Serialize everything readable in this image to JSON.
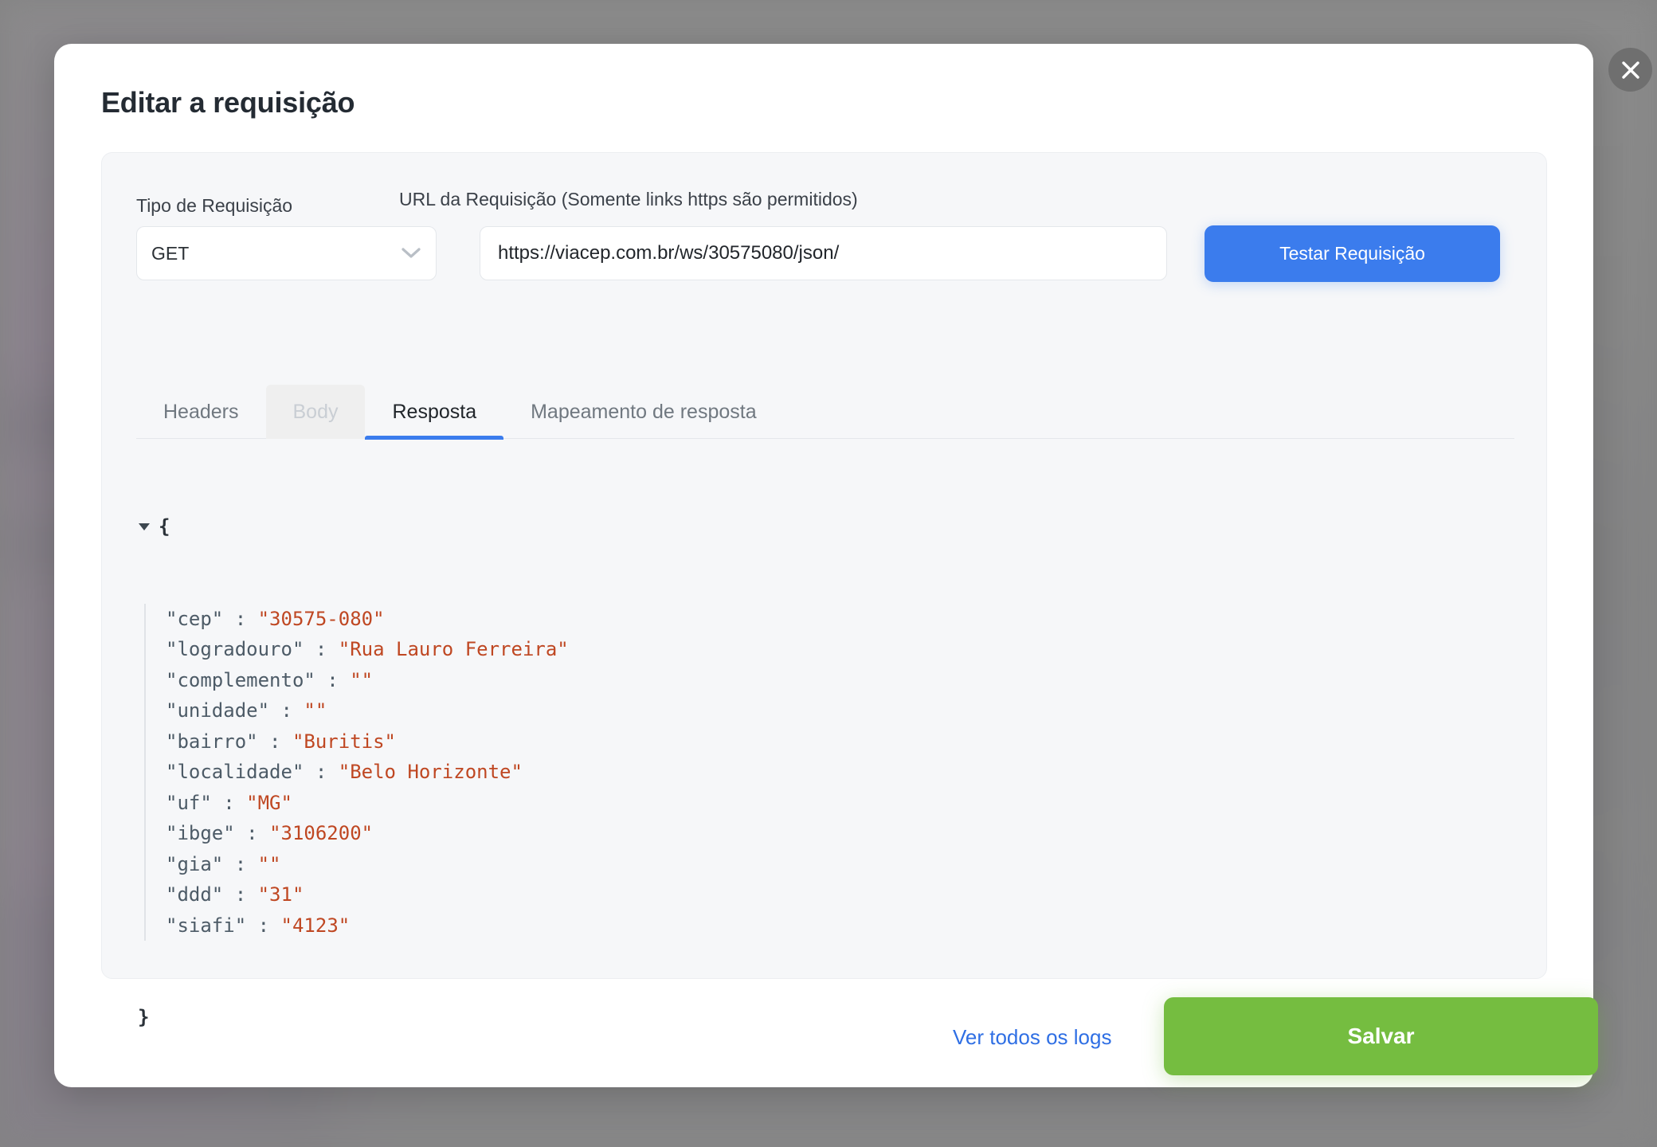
{
  "modal": {
    "title": "Editar a requisição",
    "close_icon": "close-icon"
  },
  "form": {
    "type_label": "Tipo de Requisição",
    "type_value": "GET",
    "type_chevron_icon": "chevron-down-icon",
    "url_label": "URL da Requisição (Somente links https são permitidos)",
    "url_value": "https://viacep.com.br/ws/30575080/json/",
    "url_placeholder": "https://",
    "test_button": "Testar Requisição"
  },
  "tabs": [
    {
      "label": "Headers",
      "state": "normal"
    },
    {
      "label": "Body",
      "state": "disabled"
    },
    {
      "label": "Resposta",
      "state": "active"
    },
    {
      "label": "Mapeamento de resposta",
      "state": "normal"
    }
  ],
  "response": {
    "toggle_icon": "triangle-down-icon",
    "open_brace": "{",
    "close_brace": "}",
    "entries": [
      {
        "key": "\"cep\"",
        "colon": " : ",
        "value": "\"30575-080\""
      },
      {
        "key": "\"logradouro\"",
        "colon": " : ",
        "value": "\"Rua Lauro Ferreira\""
      },
      {
        "key": "\"complemento\"",
        "colon": " : ",
        "value": "\"\""
      },
      {
        "key": "\"unidade\"",
        "colon": " : ",
        "value": "\"\""
      },
      {
        "key": "\"bairro\"",
        "colon": " : ",
        "value": "\"Buritis\""
      },
      {
        "key": "\"localidade\"",
        "colon": " : ",
        "value": "\"Belo Horizonte\""
      },
      {
        "key": "\"uf\"",
        "colon": " : ",
        "value": "\"MG\""
      },
      {
        "key": "\"ibge\"",
        "colon": " : ",
        "value": "\"3106200\""
      },
      {
        "key": "\"gia\"",
        "colon": " : ",
        "value": "\"\""
      },
      {
        "key": "\"ddd\"",
        "colon": " : ",
        "value": "\"31\""
      },
      {
        "key": "\"siafi\"",
        "colon": " : ",
        "value": "\"4123\""
      }
    ]
  },
  "footer": {
    "logs_link": "Ver todos os logs",
    "save_button": "Salvar"
  },
  "colors": {
    "accent_blue": "#3b7ced",
    "save_green": "#75bd40",
    "link_blue": "#2f6fe4",
    "json_key": "#4d5b67",
    "json_value": "#bf4722",
    "panel_bg": "#f6f7f9",
    "modal_bg": "#ffffff",
    "overlay": "#848484"
  }
}
